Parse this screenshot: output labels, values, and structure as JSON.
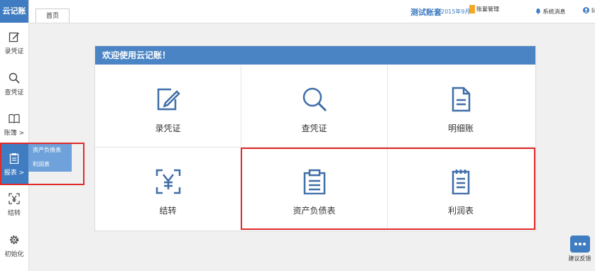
{
  "app": {
    "logo": "云记账"
  },
  "sidebar": {
    "items": [
      {
        "label": "录凭证",
        "icon": "edit-icon"
      },
      {
        "label": "查凭证",
        "icon": "search-icon"
      },
      {
        "label": "账簿 >",
        "icon": "book-icon"
      },
      {
        "label": "报表 >",
        "icon": "clipboard-icon"
      },
      {
        "label": "结转",
        "icon": "yen-icon"
      },
      {
        "label": "初始化",
        "icon": "gear-icon"
      }
    ],
    "submenu": [
      "资产负债表",
      "利润表"
    ]
  },
  "header": {
    "tab": "首页",
    "account_name": "测试账套",
    "period": "2015年9月",
    "account_manage": "账套管理",
    "messages": "系统消息",
    "user": "liyun"
  },
  "main": {
    "welcome": "欢迎使用云记账！",
    "tiles": [
      {
        "label": "录凭证",
        "icon": "edit-icon"
      },
      {
        "label": "查凭证",
        "icon": "search-icon"
      },
      {
        "label": "明细账",
        "icon": "document-icon"
      },
      {
        "label": "结转",
        "icon": "yen-icon"
      },
      {
        "label": "资产负债表",
        "icon": "clipboard-icon"
      },
      {
        "label": "利润表",
        "icon": "notepad-icon"
      }
    ]
  },
  "feedback": {
    "label": "建议反馈"
  },
  "colors": {
    "brand": "#3f7cc1",
    "highlight": "#e02b2b",
    "submenu": "#6fa2db"
  }
}
